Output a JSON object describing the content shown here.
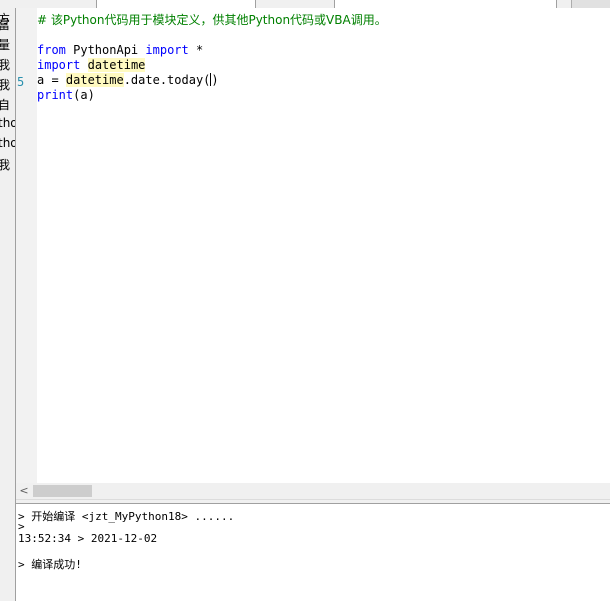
{
  "editor": {
    "line_number": "5",
    "lines": {
      "comment": "# 该Python代码用于模块定义，供其他Python代码或VBA调用。",
      "l3_kw1": "from",
      "l3_mid": " PythonApi ",
      "l3_kw2": "import",
      "l3_end": " *",
      "l4_kw": "import",
      "l4_mod": "datetime",
      "l5_a": "a = ",
      "l5_mod": "datetime",
      "l5_rest": ".date.today(",
      "l5_close": ")",
      "l6_fn": "print",
      "l6_rest": "(a)"
    }
  },
  "output": {
    "lines": [
      "> 开始编译 <jzt_MyPython18> ......",
      ">",
      "13:52:34 > 2021-12-02",
      "",
      "> 编译成功!"
    ]
  },
  "left_panel_fragments": [
    "方",
    "富",
    "量",
    "我",
    "我",
    "自",
    "tho",
    "tho",
    "我"
  ],
  "scrollbar": {
    "left_arrow": "<"
  }
}
